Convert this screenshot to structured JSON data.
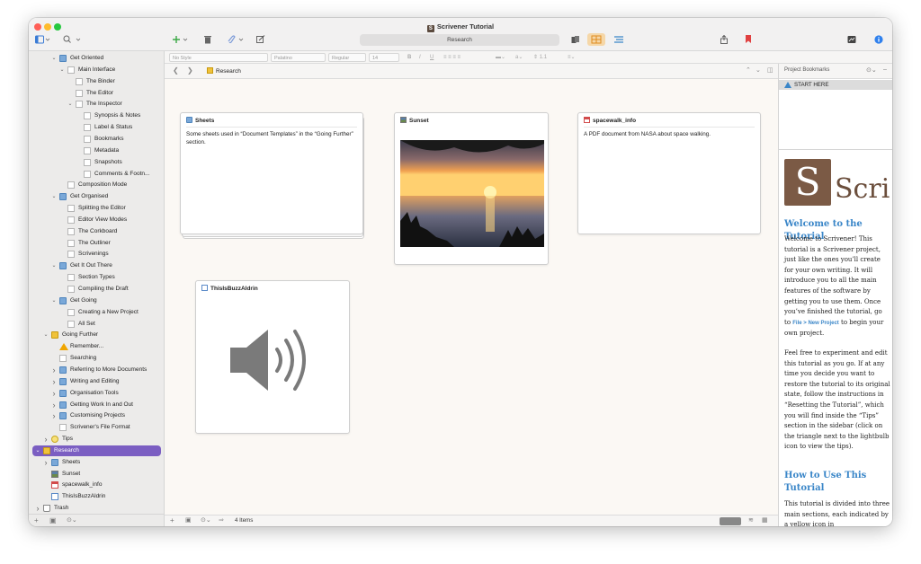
{
  "window": {
    "title": "Scrivener Tutorial",
    "search_field": "Research"
  },
  "binder": {
    "items": [
      {
        "label": "Get Oriented",
        "depth": 2,
        "icon": "folder-icon",
        "disc": "expanded"
      },
      {
        "label": "Main Interface",
        "depth": 3,
        "icon": "document-icon",
        "disc": "expanded"
      },
      {
        "label": "The Binder",
        "depth": 4,
        "icon": "document-icon",
        "disc": ""
      },
      {
        "label": "The Editor",
        "depth": 4,
        "icon": "document-icon",
        "disc": ""
      },
      {
        "label": "The Inspector",
        "depth": 4,
        "icon": "document-icon",
        "disc": "expanded"
      },
      {
        "label": "Synopsis & Notes",
        "depth": 5,
        "icon": "document-icon",
        "disc": ""
      },
      {
        "label": "Label & Status",
        "depth": 5,
        "icon": "document-icon",
        "disc": ""
      },
      {
        "label": "Bookmarks",
        "depth": 5,
        "icon": "document-icon",
        "disc": ""
      },
      {
        "label": "Metadata",
        "depth": 5,
        "icon": "document-icon",
        "disc": ""
      },
      {
        "label": "Snapshots",
        "depth": 5,
        "icon": "document-icon",
        "disc": ""
      },
      {
        "label": "Comments & Footn...",
        "depth": 5,
        "icon": "document-icon",
        "disc": ""
      },
      {
        "label": "Composition Mode",
        "depth": 3,
        "icon": "document-icon",
        "disc": ""
      },
      {
        "label": "Get Organised",
        "depth": 2,
        "icon": "folder-icon",
        "disc": "expanded"
      },
      {
        "label": "Splitting the Editor",
        "depth": 3,
        "icon": "document-icon",
        "disc": ""
      },
      {
        "label": "Editor View Modes",
        "depth": 3,
        "icon": "document-icon",
        "disc": ""
      },
      {
        "label": "The Corkboard",
        "depth": 3,
        "icon": "document-icon",
        "disc": ""
      },
      {
        "label": "The Outliner",
        "depth": 3,
        "icon": "document-icon",
        "disc": ""
      },
      {
        "label": "Scrivenings",
        "depth": 3,
        "icon": "document-icon",
        "disc": ""
      },
      {
        "label": "Get It Out There",
        "depth": 2,
        "icon": "folder-icon",
        "disc": "expanded"
      },
      {
        "label": "Section Types",
        "depth": 3,
        "icon": "document-icon",
        "disc": ""
      },
      {
        "label": "Compiling the Draft",
        "depth": 3,
        "icon": "document-icon",
        "disc": ""
      },
      {
        "label": "Get Going",
        "depth": 2,
        "icon": "folder-icon",
        "disc": "expanded"
      },
      {
        "label": "Creating a New Project",
        "depth": 3,
        "icon": "document-icon",
        "disc": ""
      },
      {
        "label": "All Set",
        "depth": 3,
        "icon": "document-icon",
        "disc": ""
      },
      {
        "label": "Going Further",
        "depth": 1,
        "icon": "yellow-folder-icon",
        "disc": "expanded"
      },
      {
        "label": "Remember...",
        "depth": 2,
        "icon": "warning-icon",
        "disc": ""
      },
      {
        "label": "Searching",
        "depth": 2,
        "icon": "document-icon",
        "disc": ""
      },
      {
        "label": "Referring to More Documents",
        "depth": 2,
        "icon": "folder-icon",
        "disc": "collapsed"
      },
      {
        "label": "Writing and Editing",
        "depth": 2,
        "icon": "folder-icon",
        "disc": "collapsed"
      },
      {
        "label": "Organisation Tools",
        "depth": 2,
        "icon": "folder-icon",
        "disc": "collapsed"
      },
      {
        "label": "Getting Work In and Out",
        "depth": 2,
        "icon": "folder-icon",
        "disc": "collapsed"
      },
      {
        "label": "Customising Projects",
        "depth": 2,
        "icon": "folder-icon",
        "disc": "collapsed"
      },
      {
        "label": "Scrivener's File Format",
        "depth": 2,
        "icon": "document-icon",
        "disc": ""
      },
      {
        "label": "Tips",
        "depth": 1,
        "icon": "lightbulb-icon",
        "disc": "collapsed"
      },
      {
        "label": "Research",
        "depth": 0,
        "icon": "research-folder-icon",
        "disc": "expanded",
        "selected": true
      },
      {
        "label": "Sheets",
        "depth": 1,
        "icon": "folder-icon",
        "disc": "collapsed"
      },
      {
        "label": "Sunset",
        "depth": 1,
        "icon": "image-icon",
        "disc": ""
      },
      {
        "label": "spacewalk_info",
        "depth": 1,
        "icon": "pdf-icon",
        "disc": ""
      },
      {
        "label": "ThisIsBuzzAldrin",
        "depth": 1,
        "icon": "audio-icon",
        "disc": ""
      },
      {
        "label": "Trash",
        "depth": 0,
        "icon": "trash-icon",
        "disc": "collapsed"
      }
    ]
  },
  "formatbar": {
    "style": "No Style",
    "font": "Palatino",
    "weight": "Regular",
    "size": "14",
    "spacing": "1.1"
  },
  "editor": {
    "breadcrumb": "Research",
    "item_count": "4 Items"
  },
  "cards": [
    {
      "title": "Sheets",
      "icon": "folder-icon",
      "body": "Some sheets used in “Document Templates” in the “Going Further” section."
    },
    {
      "title": "Sunset",
      "icon": "image-icon",
      "body": ""
    },
    {
      "title": "spacewalk_info",
      "icon": "pdf-icon",
      "body": "A PDF document from NASA about space walking."
    },
    {
      "title": "ThisIsBuzzAldrin",
      "icon": "audio-icon",
      "body": ""
    }
  ],
  "bookmarks": {
    "title": "Project Bookmarks",
    "items": [
      "START HERE"
    ]
  },
  "tutorial": {
    "logo_letter": "S",
    "logo_text": "Scri",
    "heading1": "Welcome to the Tutorial",
    "p1_before": "Welcome to Scrivener! This tutorial is a Scrivener project, just like the ones you’ll create for your own writing. It will introduce you to all the main features of the software by getting you to use them. Once you’ve finished the tutorial, go to ",
    "p1_link": "File > New Project",
    "p1_after": " to begin your own project.",
    "p2": "Feel free to experiment and edit this tutorial as you go. If at any time you decide you want to restore the tutorial to its original state, follow the instructions in “Resetting the Tutorial”, which you will find inside the “Tips” section in the sidebar (click on the triangle next to the lightbulb icon to view the tips).",
    "heading2": "How to Use This Tutorial",
    "p3": "This tutorial is divided into three main sections, each indicated by a yellow icon in"
  },
  "colors": {
    "selection": "#7b5ec2",
    "accent_link": "#3a86c8",
    "logo_brown": "#7b5a45"
  }
}
